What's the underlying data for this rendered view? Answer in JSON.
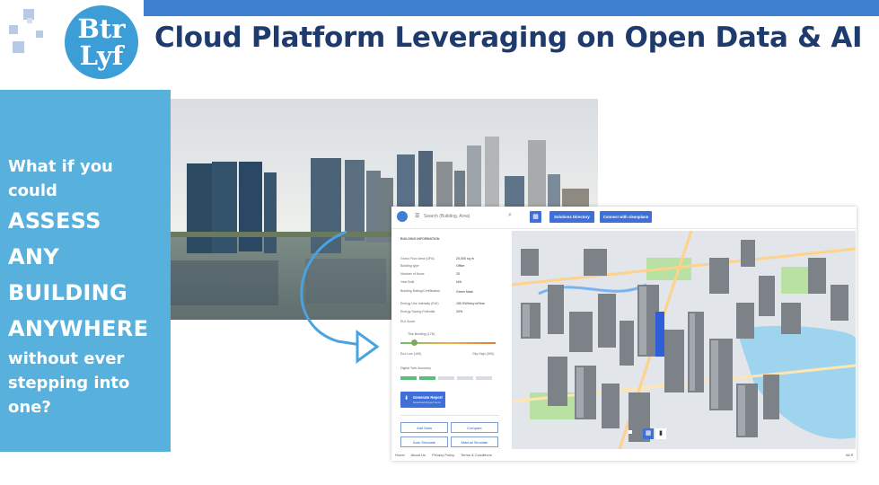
{
  "logo": {
    "line1": "Btr",
    "line2": "Lyf"
  },
  "title": "Cloud Platform Leveraging on Open Data & AI",
  "left_panel": {
    "line1": "What if you",
    "line2": "could",
    "line3": "ASSESS",
    "line4": "ANY",
    "line5": "BUILDING",
    "line6": "ANYWHERE",
    "line7": "without ever",
    "line8": "stepping  into",
    "line9": "one?"
  },
  "app": {
    "search_placeholder": "Search (Building, Area)",
    "nav_solutions": "Solutions Directory",
    "nav_connect": "Connect with cleanplans",
    "section_title": "BUILDING INFORMATION",
    "fields": [
      {
        "label": "Gross Floor Area (GFA)",
        "value": "20,000 sq m"
      },
      {
        "label": "Building type",
        "value": "Office"
      },
      {
        "label": "Number of floors",
        "value": "20"
      },
      {
        "label": "Year Built",
        "value": "N/A"
      },
      {
        "label": "Building Rating/Certification",
        "value": "Green Mark"
      },
      {
        "label": "Energy Use Intensity (EUI)",
        "value": "150 KWh/sq m/Year"
      },
      {
        "label": "Energy Saving Potential",
        "value": "20%"
      }
    ],
    "eui_score": "EUI Score",
    "this_building": "This Building (178)",
    "scale_low": "Eco Low (100)",
    "scale_high": "City High (300)",
    "digital_twin": "Digital Twin Accuracy",
    "generate_report": "Generate Report",
    "generate_sub": "Download Report Here",
    "btn_add": "Add Data",
    "btn_compare": "Compare",
    "btn_auto": "Auto Simulate",
    "btn_manual": "Manual Simulate",
    "footer": [
      "Home",
      "About Us",
      "Privacy Policy",
      "Terms & Conditions"
    ],
    "footer_right": "All R"
  },
  "colors": {
    "accent": "#3f7fcf",
    "panel": "#58b0dc",
    "title": "#1f3b6e"
  }
}
